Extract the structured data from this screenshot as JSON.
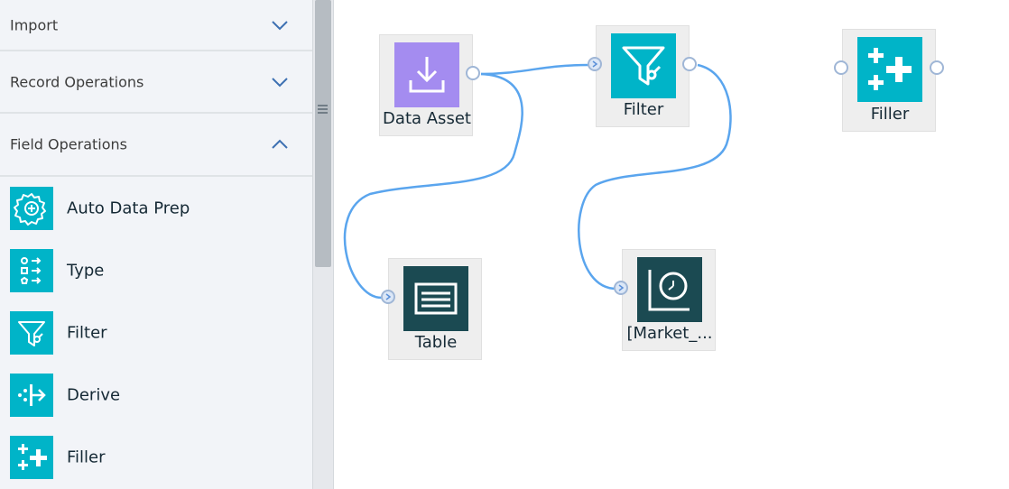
{
  "sidebar": {
    "sections": [
      {
        "label": "Import",
        "expanded": false
      },
      {
        "label": "Record Operations",
        "expanded": false
      },
      {
        "label": "Field Operations",
        "expanded": true
      }
    ],
    "items": [
      {
        "label": "Auto Data Prep",
        "icon": "gear-plus-icon"
      },
      {
        "label": "Type",
        "icon": "type-icon"
      },
      {
        "label": "Filter",
        "icon": "filter-icon"
      },
      {
        "label": "Derive",
        "icon": "derive-icon"
      },
      {
        "label": "Filler",
        "icon": "filler-icon"
      }
    ]
  },
  "canvas": {
    "nodes": [
      {
        "id": "data-asset",
        "label": "Data Asset",
        "icon": "download-icon",
        "color": "#a48cf0"
      },
      {
        "id": "filter",
        "label": "Filter",
        "icon": "filter-icon",
        "color": "#00b4c8"
      },
      {
        "id": "filler",
        "label": "Filler",
        "icon": "filler-icon",
        "color": "#00b4c8"
      },
      {
        "id": "table",
        "label": "Table",
        "icon": "table-icon",
        "color": "#1b4a52"
      },
      {
        "id": "market",
        "label": "[Market_...",
        "icon": "time-plot-icon",
        "color": "#1b4a52"
      }
    ]
  },
  "colors": {
    "sidebar_bg": "#f2f4f8",
    "tile": "#00b4c8",
    "link": "#5aa5ee",
    "port_border": "#9fb6d6"
  }
}
